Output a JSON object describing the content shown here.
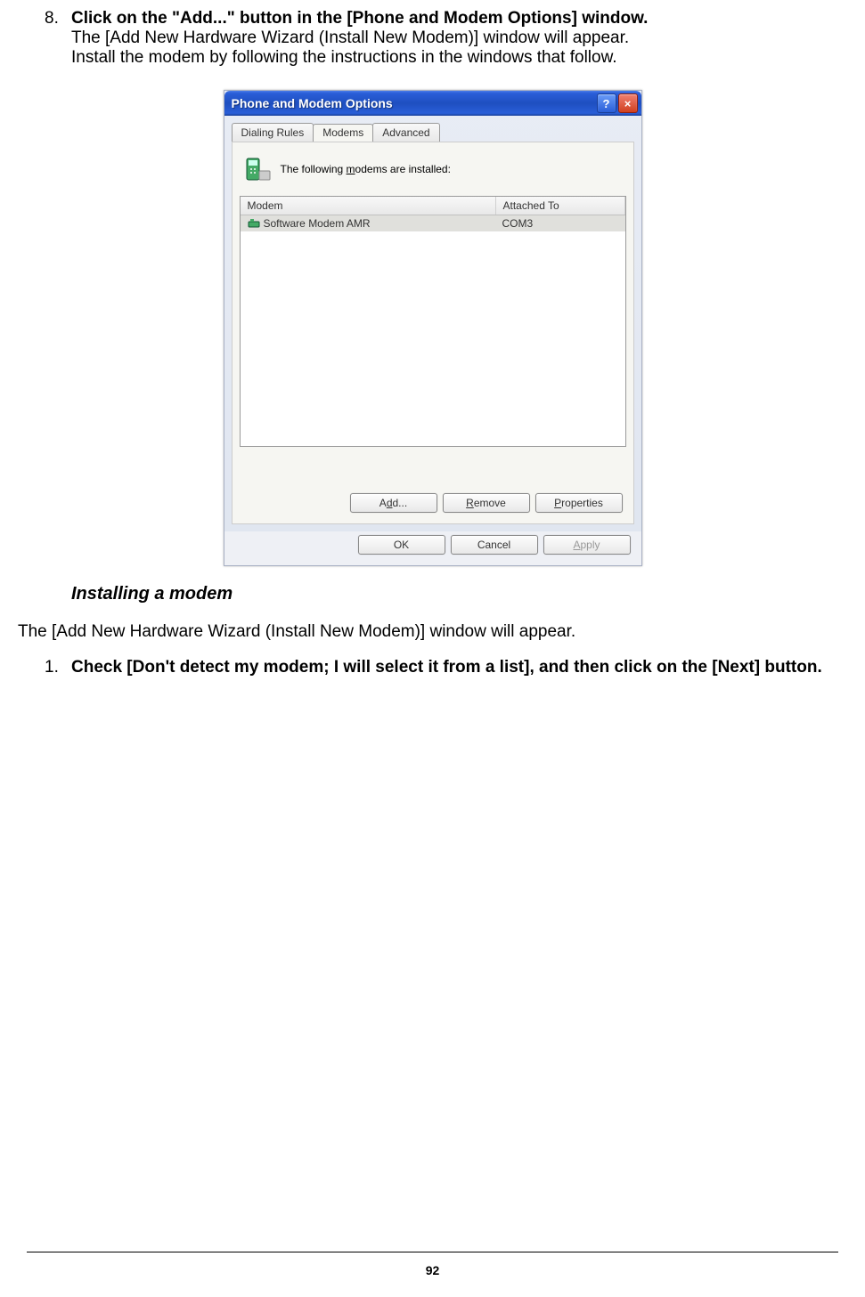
{
  "step8": {
    "number": "8.",
    "bold_line": "Click on the \"Add...\" button in the [Phone and Modem Options] window.",
    "line2": "The [Add New Hardware Wizard (Install New Modem)] window will appear.",
    "line3": "Install the modem by following the instructions in the windows that follow."
  },
  "dialog": {
    "title": "Phone and Modem Options",
    "help_btn": "?",
    "close_btn": "×",
    "tabs": [
      "Dialing Rules",
      "Modems",
      "Advanced"
    ],
    "active_tab_index": 1,
    "info_text_pre": "The following ",
    "info_text_underlined": "m",
    "info_text_post": "odems are installed:",
    "columns": {
      "c1": "Modem",
      "c2": "Attached To"
    },
    "rows": [
      {
        "name": "Software Modem AMR",
        "port": "COM3"
      }
    ],
    "buttons": {
      "add_pre": "A",
      "add_u": "d",
      "add_post": "d...",
      "remove_u": "R",
      "remove_post": "emove",
      "prop_u": "P",
      "prop_post": "roperties",
      "ok": "OK",
      "cancel": "Cancel",
      "apply_u": "A",
      "apply_post": "pply"
    }
  },
  "subheading": "Installing a modem",
  "paragraph": "The [Add New Hardware Wizard (Install New Modem)] window will appear.",
  "step1": {
    "number": "1.",
    "text": "Check [Don't detect my modem; I will select it from a list], and then click on the [Next] button."
  },
  "page_number": "92"
}
